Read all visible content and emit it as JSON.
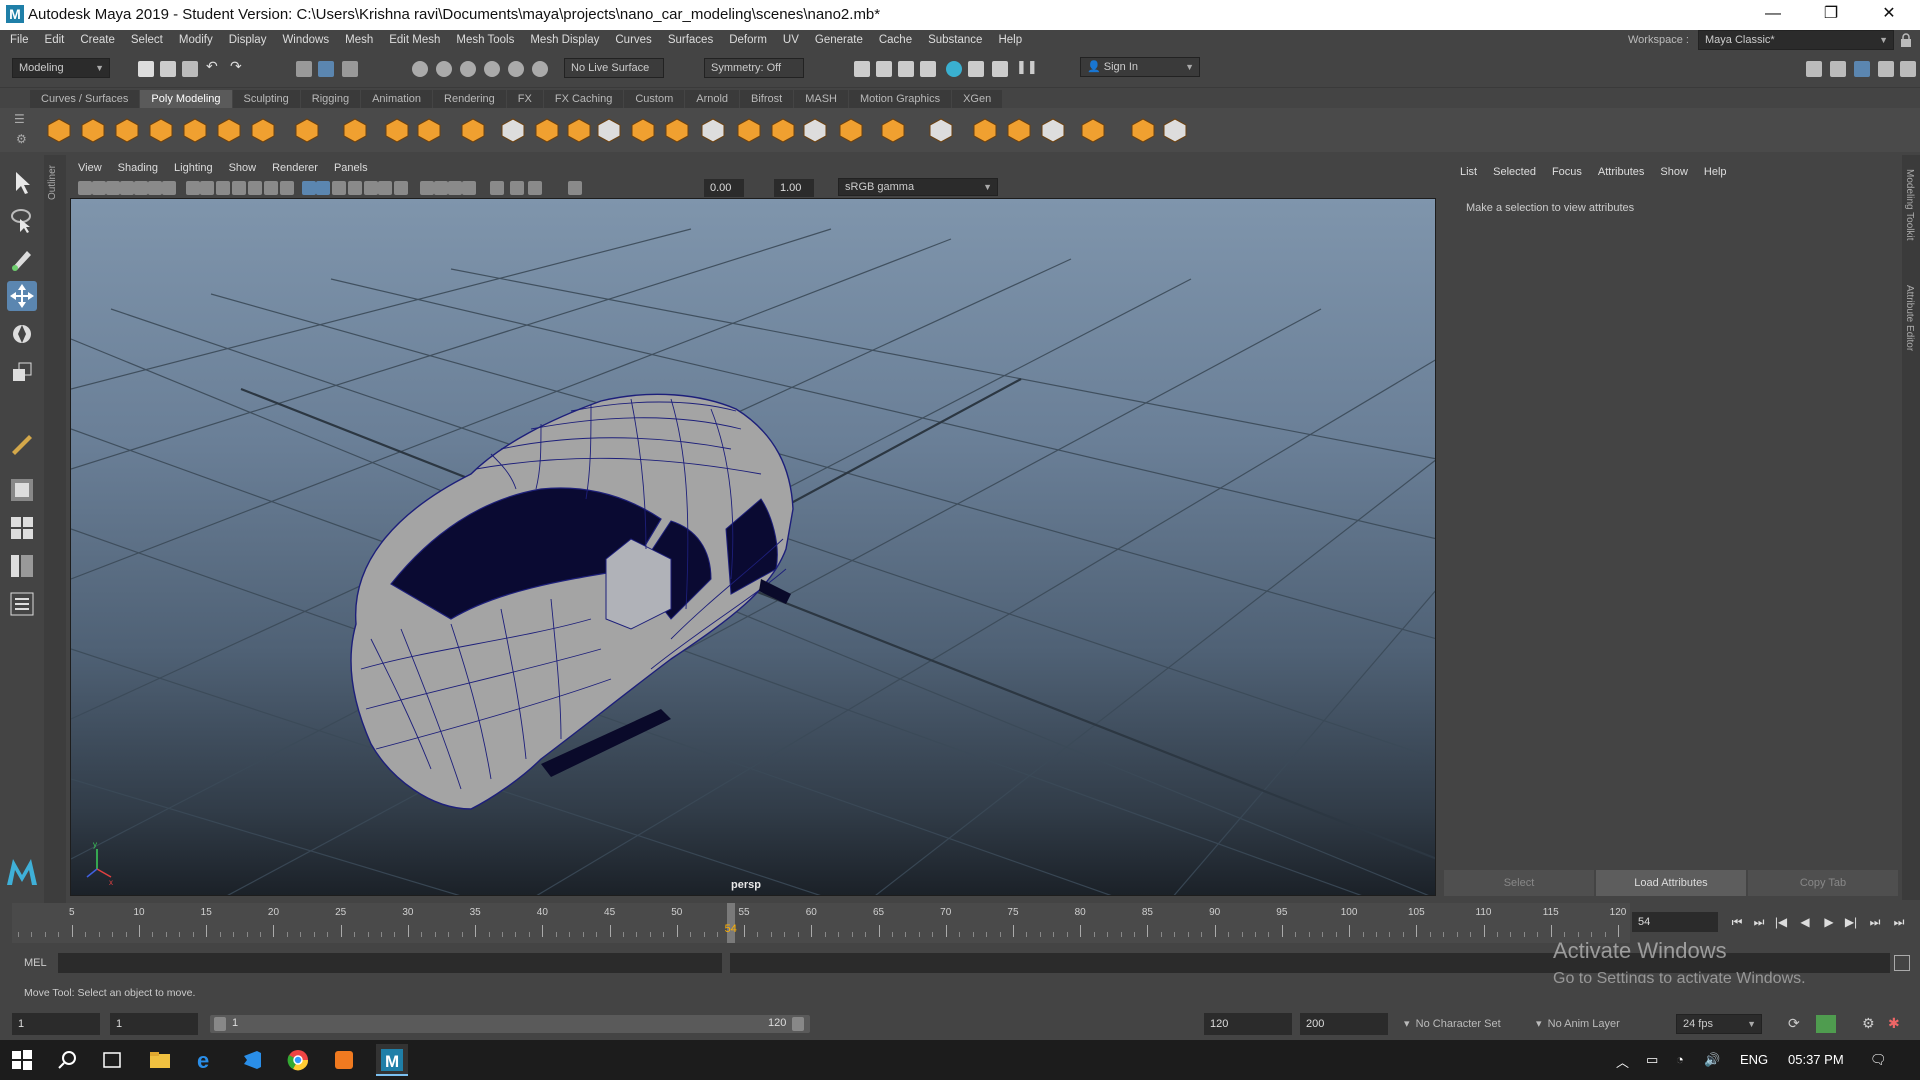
{
  "window": {
    "title": "Autodesk Maya 2019 - Student Version: C:\\Users\\Krishna ravi\\Documents\\maya\\projects\\nano_car_modeling\\scenes\\nano2.mb*",
    "minimize": "—",
    "maximize": "❐",
    "close": "✕",
    "logo": "M"
  },
  "menubar": {
    "items": [
      "File",
      "Edit",
      "Create",
      "Select",
      "Modify",
      "Display",
      "Windows",
      "Mesh",
      "Edit Mesh",
      "Mesh Tools",
      "Mesh Display",
      "Curves",
      "Surfaces",
      "Deform",
      "UV",
      "Generate",
      "Cache",
      "Substance",
      "Help"
    ],
    "workspace_label": "Workspace :",
    "workspace_value": "Maya Classic*"
  },
  "statusline": {
    "menuset": "Modeling",
    "live_surface": "No Live Surface",
    "symmetry": "Symmetry: Off",
    "sign_in": "Sign In"
  },
  "shelf": {
    "tabs": [
      "Curves / Surfaces",
      "Poly Modeling",
      "Sculpting",
      "Rigging",
      "Animation",
      "Rendering",
      "FX",
      "FX Caching",
      "Custom",
      "Arnold",
      "Bifrost",
      "MASH",
      "Motion Graphics",
      "XGen"
    ],
    "active_tab": "Poly Modeling",
    "accent": "#f0a030"
  },
  "panel": {
    "menus": [
      "View",
      "Shading",
      "Lighting",
      "Show",
      "Renderer",
      "Panels"
    ],
    "exposure": "0.00",
    "gamma": "1.00",
    "colorspace": "sRGB gamma",
    "camera": "persp"
  },
  "outliner_label": "Outliner",
  "attribute_editor": {
    "tabs": [
      "List",
      "Selected",
      "Focus",
      "Attributes",
      "Show",
      "Help"
    ],
    "message": "Make a selection to view attributes",
    "buttons": [
      "Select",
      "Load Attributes",
      "Copy Tab"
    ]
  },
  "right_strip": [
    "Modeling Toolkit",
    "Attribute Editor"
  ],
  "timeline": {
    "ticks": [
      5,
      10,
      15,
      20,
      25,
      30,
      35,
      40,
      45,
      50,
      55,
      60,
      65,
      70,
      75,
      80,
      85,
      90,
      95,
      100,
      105,
      110,
      115,
      120
    ],
    "current_frame": "54",
    "current_frame_field": "54"
  },
  "mel": {
    "label": "MEL"
  },
  "watermark": {
    "line1": "Activate Windows",
    "line2": "Go to Settings to activate Windows."
  },
  "helpline": "Move Tool: Select an object to move.",
  "range": {
    "start": "1",
    "playback_start": "1",
    "slider_start": "1",
    "slider_end": "120",
    "playback_end": "120",
    "end": "200",
    "character_set": "No Character Set",
    "anim_layer": "No Anim Layer",
    "fps": "24 fps"
  },
  "taskbar": {
    "language": "ENG",
    "time": "05:37 PM"
  }
}
